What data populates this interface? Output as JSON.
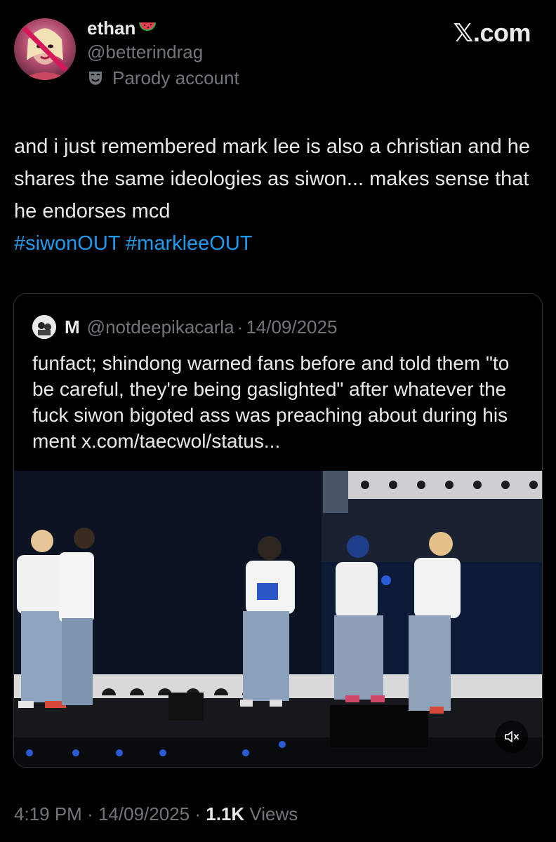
{
  "author": {
    "display_name": "ethan",
    "name_emoji": "watermelon-emoji",
    "handle": "@betterindrag",
    "label": "Parody account",
    "label_icon": "parody-mask-icon"
  },
  "site_logo": "𝕏.com",
  "tweet": {
    "text": "and i just remembered mark lee is also a christian and he shares the same ideologies as siwon... makes sense that he endorses mcd",
    "hashtags": [
      "#siwonOUT",
      "#markleeOUT"
    ]
  },
  "quoted_tweet": {
    "name": "M",
    "handle": "@notdeepikacarla",
    "separator": "·",
    "date": "14/09/2025",
    "text": "funfact; shindong warned fans before and told them \"to be careful, they're being gaslighted\" after whatever the fuck siwon bigoted ass was preaching about during his ment x.com/taecwol/status...",
    "media_controls": {
      "mute_icon": "speaker-muted-icon"
    }
  },
  "footer": {
    "time": "4:19 PM",
    "separator": "·",
    "date": "14/09/2025",
    "views_count": "1.1K",
    "views_label": "Views"
  },
  "colors": {
    "background": "#000000",
    "text": "#e7e9ea",
    "secondary": "#71767b",
    "link": "#1d9bf0",
    "border": "#2f3336"
  }
}
